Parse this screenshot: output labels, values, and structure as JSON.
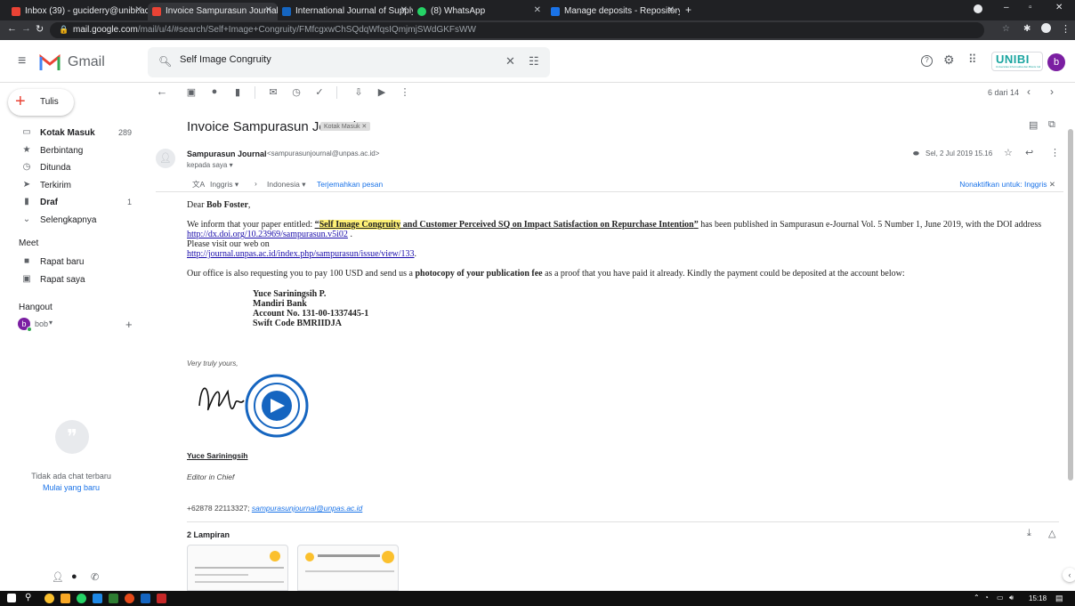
{
  "browser": {
    "tabs": [
      {
        "label": "Inbox (39) - guciderry@unibi.ac.i",
        "icon": "gmail-icon",
        "color": "#ea4335"
      },
      {
        "label": "Invoice Sampurasun Journal - bo",
        "icon": "gmail-icon",
        "color": "#ea4335"
      },
      {
        "label": "International Journal of Supply C",
        "icon": "journal-icon",
        "color": "#1565c0"
      },
      {
        "label": "(8) WhatsApp",
        "icon": "whatsapp-icon",
        "color": "#25d366"
      },
      {
        "label": "Manage deposits - Repository U",
        "icon": "repository-icon",
        "color": "#1a73e8"
      }
    ],
    "url_host": "mail.google.com",
    "url_path": "/mail/u/4/#search/Self+Image+Congruity/FMfcgxwChSQdqWfqsIQmjmjSWdGKFsWW"
  },
  "header": {
    "app_name": "Gmail",
    "search_value": "Self Image Congruity",
    "org_logo": "UNIBI",
    "org_sub": "Universitas Informatika dan Bisnis Indonesia",
    "avatar_letter": "b",
    "accent": "#7b1fa2"
  },
  "sidebar": {
    "compose_label": "Tulis",
    "items": [
      {
        "label": "Kotak Masuk",
        "count": "289",
        "icon": "inbox-icon"
      },
      {
        "label": "Berbintang",
        "count": "",
        "icon": "star-icon"
      },
      {
        "label": "Ditunda",
        "count": "",
        "icon": "clock-icon"
      },
      {
        "label": "Terkirim",
        "count": "",
        "icon": "send-icon"
      },
      {
        "label": "Draf",
        "count": "1",
        "icon": "draft-icon"
      },
      {
        "label": "Selengkapnya",
        "count": "",
        "icon": "chevron-down-icon"
      }
    ],
    "meet_heading": "Meet",
    "meet_items": [
      "Rapat baru",
      "Rapat saya"
    ],
    "hangout_heading": "Hangout",
    "hangout_user": "bob",
    "no_chat": "Tidak ada chat terbaru",
    "start_new": "Mulai yang baru"
  },
  "toolbar": {
    "pager": "6 dari 14"
  },
  "email": {
    "subject": "Invoice Sampurasun Journal",
    "label_chip": "Kotak Masuk",
    "sender_name": "Sampurasun Journal",
    "sender_email": "<sampurasunjournal@unpas.ac.id>",
    "to_line": "kepada saya",
    "date": "Sel, 2 Jul 2019 15.16",
    "translate_from": "Inggris",
    "translate_to": "Indonesia",
    "translate_action": "Terjemahkan pesan",
    "translate_off": "Nonaktifkan untuk: Inggris",
    "greeting_prefix": "Dear ",
    "greeting_name": "Bob Foster",
    "greeting_suffix": ",",
    "p1_prefix": "We inform that your paper entitled: ",
    "p1_open_quote": "“",
    "p1_highlight": "Self Image Congruity",
    "p1_title_rest": " and Customer Perceived SQ on Impact Satisfaction on Repurchase Intention",
    "p1_close_quote": "”",
    "p1_suffix": "  has been published in Sampurasun e-Journal Vol. 5 Number 1, June 2019, with the DOI address",
    "doi_link": "http://dx.doi.org/10.23969/sampurasun.v5i02",
    "doi_dot": " .",
    "visit_line": "Please visit our web on",
    "web_link": "http://journal.unpas.ac.id/index.php/sampurasun/issue/view/133",
    "web_dot": ".",
    "p2_prefix": "Our office is also requesting you to pay 100 USD and send us a ",
    "p2_bold": "photocopy of your publication fee",
    "p2_suffix": " as a proof that you have paid it already. Kindly the payment could be deposited at the account below:",
    "account": [
      "Yuce Sariningsih P.",
      "Mandiri Bank",
      "Account No. 131-00-1337445-1",
      "Swift Code BMRIIDJA"
    ],
    "closing": "Very truly yours,",
    "signer": "Yuce Sariningsih",
    "role": "Editor in Chief",
    "phone": "+62878 22113327; ",
    "contact_email": "sampurasunjournal@unpas.ac.id",
    "attachments_label": "2 Lampiran"
  },
  "taskbar": {
    "time": "15:18"
  }
}
